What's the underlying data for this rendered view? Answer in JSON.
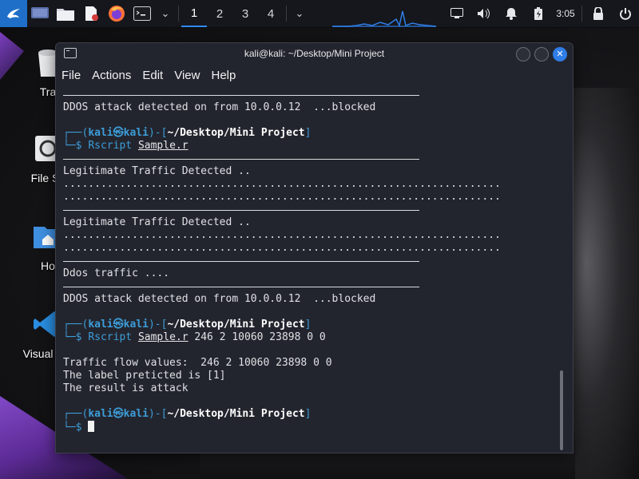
{
  "taskbar": {
    "workspaces": [
      "1",
      "2",
      "3",
      "4"
    ],
    "active_workspace": "1",
    "clock": "3:05",
    "icons": [
      "kali-menu-icon",
      "show-desktop-icon",
      "file-manager-icon",
      "text-editor-icon",
      "firefox-icon",
      "terminal-icon"
    ]
  },
  "desktop": {
    "icons": [
      {
        "label": "Tra",
        "icon": "trash-icon"
      },
      {
        "label": "File Sy",
        "icon": "filesystem-icon"
      },
      {
        "label": "Ho",
        "icon": "home-folder-icon"
      },
      {
        "label": "Visual Stu",
        "icon": "vscode-icon"
      }
    ]
  },
  "terminal": {
    "title": "kali@kali: ~/Desktop/Mini Project",
    "menu": [
      "File",
      "Actions",
      "Edit",
      "View",
      "Help"
    ],
    "prompt": {
      "open": "┌──(",
      "user": "kali",
      "at": "㉿",
      "host": "kali",
      "mid": ")-[",
      "path": "~/Desktop/Mini Project",
      "close": "]",
      "second": "└─$ "
    },
    "lines": {
      "l1": "DDOS attack detected on from 10.0.0.12  ...blocked",
      "cmd1_program": "Rscript",
      "cmd1_file": "Sample.r",
      "l2": "Legitimate Traffic Detected ..",
      "dots1": "......................................................................",
      "dots2": "......................................................................",
      "l3": "Legitimate Traffic Detected ..",
      "dots3": "......................................................................",
      "dots4": "......................................................................",
      "l4": "Ddos traffic ....",
      "l5": "DDOS attack detected on from 10.0.0.12  ...blocked",
      "cmd2_program": "Rscript",
      "cmd2_file": "Sample.r",
      "cmd2_args": " 246 2 10060 23898 0 0",
      "l6": "Traffic flow values:  246 2 10060 23898 0 0",
      "l7": "The label preticted is [1]",
      "l8": "The result is attack"
    }
  },
  "colors": {
    "prompt_blue": "#3c9dd8",
    "kali_accent": "#1f6fc9"
  }
}
